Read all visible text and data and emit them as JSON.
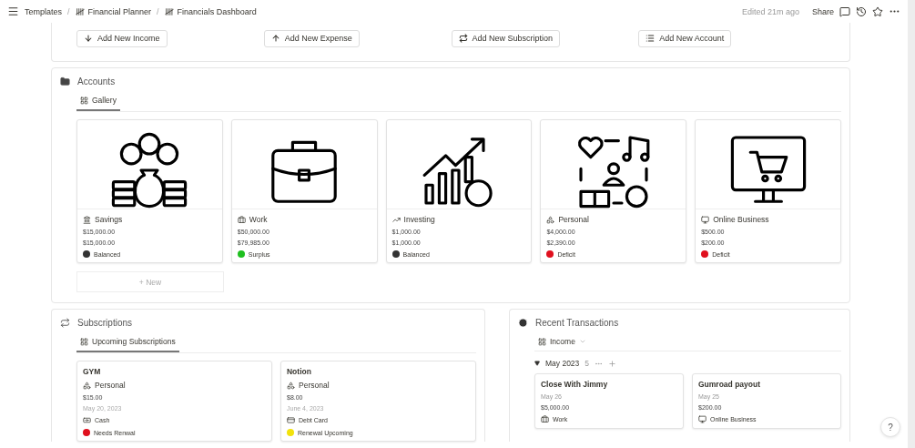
{
  "breadcrumbs": [
    {
      "label": "Templates",
      "icon": false
    },
    {
      "separator": "/",
      "label": "Financial Planner",
      "icon": true
    },
    {
      "separator": "/",
      "label": "Financials Dashboard",
      "icon": true
    }
  ],
  "edited": "Edited 21m ago",
  "share": "Share",
  "actions": [
    {
      "kind": "down",
      "label": "Add New Income"
    },
    {
      "kind": "up",
      "label": "Add New Expense"
    },
    {
      "kind": "repeat",
      "label": "Add New Subscription"
    },
    {
      "kind": "list",
      "label": "Add New Account"
    }
  ],
  "accounts": {
    "title": "Accounts",
    "tab": "Gallery",
    "new": "+ New",
    "cards": [
      {
        "kind": "savings",
        "name": "Savings",
        "amount_1": "$15,000.00",
        "amount_2": "$15,000.00",
        "status": "Balanced",
        "color": "#333333"
      },
      {
        "kind": "work",
        "name": "Work",
        "amount_1": "$50,000.00",
        "amount_2": "$79,985.00",
        "status": "Surplus",
        "color": "#1fbf1f"
      },
      {
        "kind": "investing",
        "name": "Investing",
        "amount_1": "$1,000.00",
        "amount_2": "$1,000.00",
        "status": "Balanced",
        "color": "#333333"
      },
      {
        "kind": "personal",
        "name": "Personal",
        "amount_1": "$4,000.00",
        "amount_2": "$2,390.00",
        "status": "Deficit",
        "color": "#e0101e"
      },
      {
        "kind": "business",
        "name": "Online Business",
        "amount_1": "$500.00",
        "amount_2": "$200.00",
        "status": "Deficit",
        "color": "#e0101e"
      }
    ]
  },
  "subscriptions": {
    "title": "Subscriptions",
    "tab": "Upcoming Subscriptions",
    "cards": [
      {
        "name": "GYM",
        "category": "Personal",
        "price": "$15.00",
        "date": "May 20, 2023",
        "method": {
          "kind": "cash",
          "label": "Cash"
        },
        "status": "Needs Renwal",
        "color": "#e0101e"
      },
      {
        "name": "Notion",
        "category": "Personal",
        "price": "$8.00",
        "date": "June 4, 2023",
        "method": {
          "kind": "card",
          "label": "Debt Card"
        },
        "status": "Renewal Upcoming",
        "color": "#f2e20c"
      }
    ]
  },
  "transactions": {
    "title": "Recent Transactions",
    "view": "Income",
    "group": {
      "label": "May 2023",
      "count": "5",
      "expanded": true
    },
    "cards": [
      {
        "name": "Close With Jimmy",
        "date": "May 26",
        "amount": "$5,000.00",
        "account": {
          "kind": "work",
          "label": "Work"
        }
      },
      {
        "name": "Gumroad payout",
        "date": "May 25",
        "amount": "$200.00",
        "account": {
          "kind": "business",
          "label": "Online Business"
        }
      }
    ]
  },
  "help": "?"
}
